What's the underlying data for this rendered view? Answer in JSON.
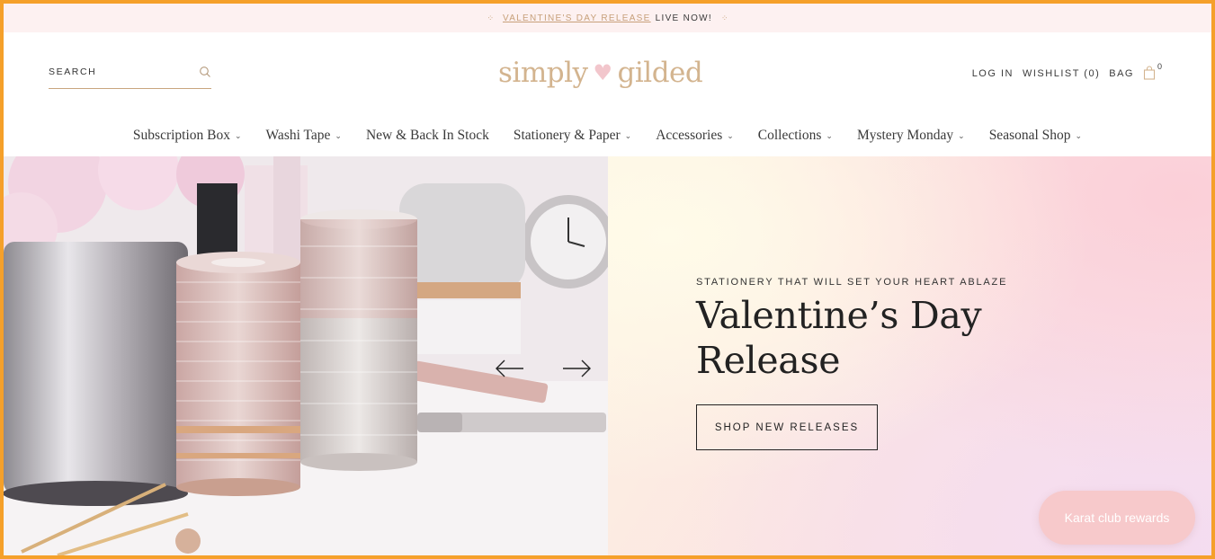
{
  "announcement": {
    "sparkle_left": "⁘",
    "sparkle_right": "⁘",
    "link_text": "VALENTINE'S DAY RELEASE",
    "suffix": "LIVE NOW!"
  },
  "header": {
    "search_placeholder": "SEARCH",
    "logo_left": "simply",
    "logo_heart": "♥",
    "logo_right": "gilded",
    "login": "LOG IN",
    "wishlist": "WISHLIST (0)",
    "bag": "BAG",
    "bag_count": "0"
  },
  "nav": {
    "items": [
      {
        "label": "Subscription Box",
        "dropdown": "⌄"
      },
      {
        "label": "Washi Tape",
        "dropdown": "⌄"
      },
      {
        "label": "New & Back In Stock"
      },
      {
        "label": "Stationery & Paper",
        "dropdown": "⌄"
      },
      {
        "label": "Accessories",
        "dropdown": "⌄"
      },
      {
        "label": "Collections",
        "dropdown": "⌄"
      },
      {
        "label": "Mystery Monday",
        "dropdown": "⌄"
      },
      {
        "label": "Seasonal Shop",
        "dropdown": "⌄"
      }
    ]
  },
  "hero": {
    "eyebrow": "STATIONERY THAT WILL SET YOUR HEART ABLAZE",
    "headline_line1": "Valentine’s Day",
    "headline_line2": "Release",
    "cta": "SHOP NEW RELEASES"
  },
  "rewards": {
    "label": "Karat club rewards"
  },
  "colors": {
    "accent_gold": "#c9a57e",
    "announce_bg": "#fdf1f1",
    "rewards_bg": "#f7c9cb",
    "frame_border": "#f5a02a"
  }
}
